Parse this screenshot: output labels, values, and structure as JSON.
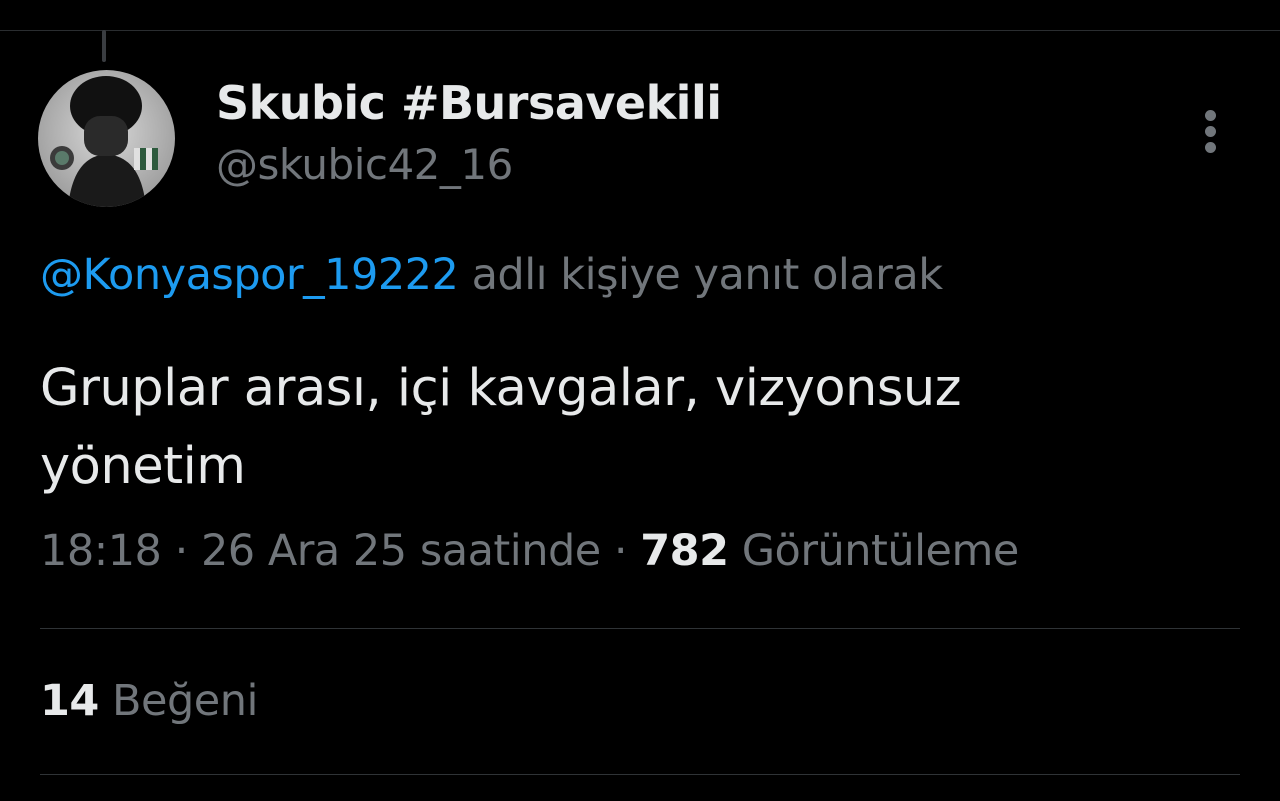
{
  "tweet": {
    "author": {
      "display_name": "Skubic #Bursavekili",
      "handle": "@skubic42_16",
      "avatar_icon": "profile-photo"
    },
    "reply_to": {
      "mention": "@Konyaspor_19222",
      "suffix": "adlı kişiye yanıt olarak"
    },
    "text_lines": [
      "Gruplar arası, içi kavgalar, vizyonsuz",
      "yönetim"
    ],
    "meta": {
      "time": "18:18",
      "separator": "·",
      "date": "26 Ara 25 saatinde",
      "views_count": "782",
      "views_label": "Görüntüleme"
    },
    "stats": {
      "likes_count": "14",
      "likes_label": "Beğeni"
    },
    "more_icon": "more-vertical-icon"
  },
  "colors": {
    "background": "#000000",
    "primary_text": "#e7e9ea",
    "secondary_text": "#71767b",
    "link": "#1d9bf0",
    "divider": "#2f3336"
  }
}
